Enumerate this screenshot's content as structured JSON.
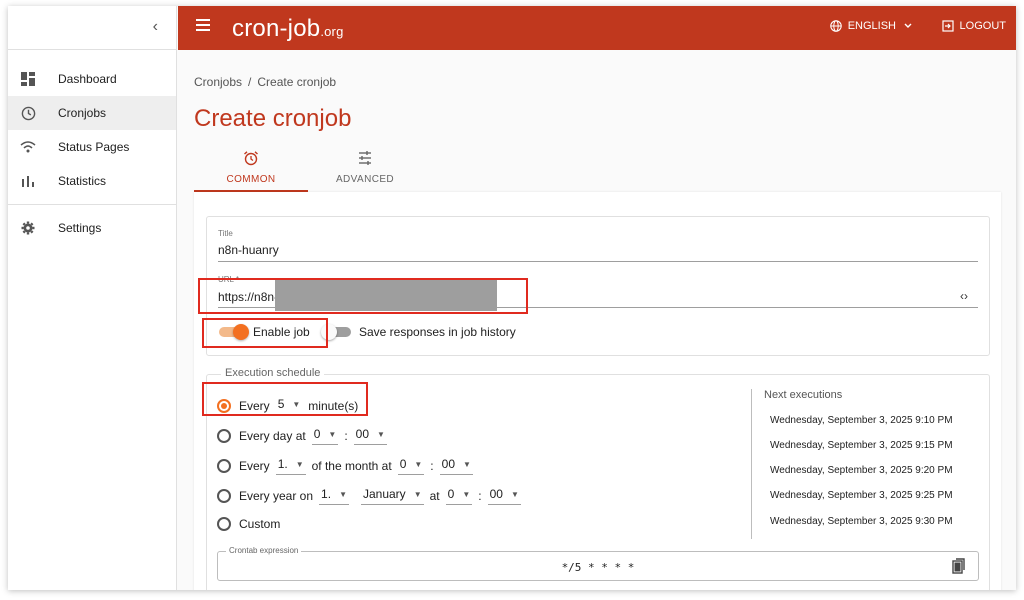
{
  "app": {
    "logo_main": "cron-job",
    "logo_suffix": ".org"
  },
  "topbar": {
    "language": "ENGLISH",
    "logout": "LOGOUT"
  },
  "sidebar": {
    "items": [
      {
        "label": "Dashboard",
        "icon": "dashboard-icon"
      },
      {
        "label": "Cronjobs",
        "icon": "clock-icon",
        "active": true
      },
      {
        "label": "Status Pages",
        "icon": "signal-icon"
      },
      {
        "label": "Statistics",
        "icon": "bar-chart-icon"
      },
      {
        "label": "Settings",
        "icon": "gear-icon"
      }
    ]
  },
  "breadcrumb": {
    "root": "Cronjobs",
    "separator": "/",
    "current": "Create cronjob"
  },
  "page": {
    "title": "Create cronjob"
  },
  "tabs": [
    {
      "label": "COMMON",
      "icon": "alarm-clock-icon",
      "active": true
    },
    {
      "label": "ADVANCED",
      "icon": "sliders-icon",
      "active": false
    }
  ],
  "form": {
    "title_label": "Title",
    "title_value": "n8n-huanry",
    "url_label": "URL *",
    "url_value": "https://n8n-",
    "enable_job_label": "Enable job",
    "enable_job": true,
    "save_responses_label": "Save responses in job history",
    "save_responses": false
  },
  "schedule": {
    "legend": "Execution schedule",
    "every": {
      "prefix": "Every",
      "value": "5",
      "suffix": "minute(s)"
    },
    "every_day": {
      "prefix": "Every day at",
      "hour": "0",
      "colon": ":",
      "minute": "00"
    },
    "every_month": {
      "prefix": "Every",
      "day": "1.",
      "middle": "of the month at",
      "hour": "0",
      "colon": ":",
      "minute": "00"
    },
    "every_year": {
      "prefix": "Every year on",
      "day": "1.",
      "month": "January",
      "at": "at",
      "hour": "0",
      "colon": ":",
      "minute": "00"
    },
    "custom": {
      "label": "Custom"
    },
    "next_title": "Next executions",
    "next_executions": [
      "Wednesday, September 3, 2025 9:10 PM",
      "Wednesday, September 3, 2025 9:15 PM",
      "Wednesday, September 3, 2025 9:20 PM",
      "Wednesday, September 3, 2025 9:25 PM",
      "Wednesday, September 3, 2025 9:30 PM"
    ],
    "crontab_label": "Crontab expression",
    "crontab_value": "*/5 * * * *"
  },
  "colors": {
    "brand": "#c0381e",
    "accent": "#f37021",
    "highlight": "#e02a1f"
  }
}
